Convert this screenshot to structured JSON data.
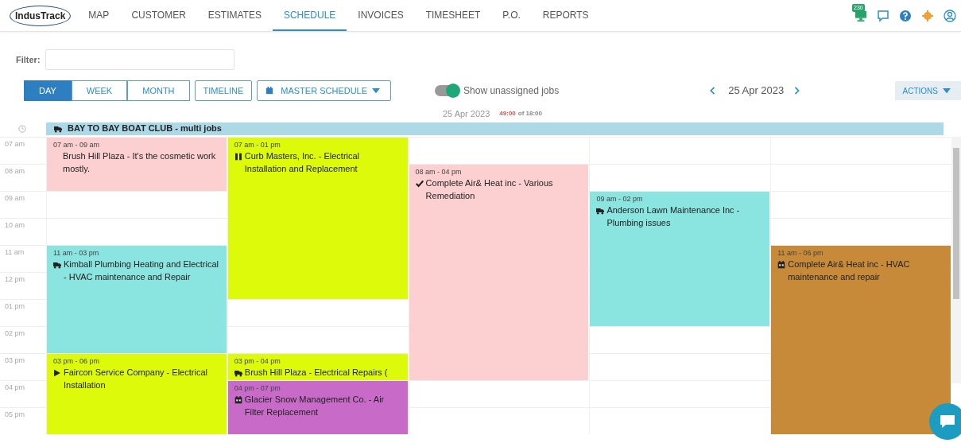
{
  "logo": "IndusTrack",
  "tabs": [
    {
      "label": "MAP",
      "selected": false
    },
    {
      "label": "CUSTOMER",
      "selected": false
    },
    {
      "label": "ESTIMATES",
      "selected": false
    },
    {
      "label": "SCHEDULE",
      "selected": true
    },
    {
      "label": "INVOICES",
      "selected": false
    },
    {
      "label": "TIMESHEET",
      "selected": false
    },
    {
      "label": "P.O.",
      "selected": false
    },
    {
      "label": "REPORTS",
      "selected": false
    }
  ],
  "notification_count": "230",
  "filter": {
    "label": "Filter:"
  },
  "views": [
    {
      "label": "DAY",
      "selected": true
    },
    {
      "label": "WEEK",
      "selected": false
    },
    {
      "label": "MONTH",
      "selected": false
    }
  ],
  "timeline_button": "TIMELINE",
  "schedule_dropdown": "MASTER SCHEDULE",
  "unassigned_toggle": {
    "label": "Show unassigned jobs",
    "on": true
  },
  "date_nav": "25 Apr 2023",
  "actions": "ACTIONS",
  "summary": {
    "date": "25 Apr 2023",
    "hours_used": "49:00",
    "hours_total": "of 18:00"
  },
  "all_day": {
    "title": "BAY TO BAY BOAT CLUB - multi jobs",
    "kind": "truck"
  },
  "calendar": {
    "time_slots": [
      "07 am",
      "08 am",
      "09 am",
      "10 am",
      "11 am",
      "12 pm",
      "01 pm",
      "02 pm",
      "03 pm",
      "04 pm",
      "05 pm"
    ],
    "lanes": [
      [
        {
          "time": "07 am - 09 am",
          "title": "Brush Hill Plaza - It's the cosmetic work mostly.",
          "kind": "plain",
          "color": "#fccfd0"
        },
        {
          "time": "11 am - 03 pm",
          "title": "Kimball Plumbing Heating and Electrical - HVAC maintenance and Repair",
          "kind": "truck",
          "color": "#8ae4e0"
        },
        {
          "time": "03 pm - 06 pm",
          "title": "Faircon Service Company - Electrical Installation",
          "kind": "play",
          "color": "#dcfa0a"
        }
      ],
      [
        {
          "time": "07 am - 01 pm",
          "title": "Curb Masters, Inc. - Electrical Installation and Replacement",
          "kind": "pause",
          "color": "#dcfa0a"
        },
        {
          "time": "03 pm - 04 pm",
          "title": "Brush Hill Plaza - Electrical Repairs (",
          "kind": "truck",
          "color": "#dcfa0a"
        },
        {
          "time": "04 pm - 07 pm",
          "title": "Glacier Snow Management Co. - Air Filter Replacement",
          "kind": "calendar",
          "color": "#c86bc8"
        }
      ],
      [
        {
          "time": "08 am - 04 pm",
          "title": "Complete Air& Heat inc - Various Remediation",
          "kind": "check",
          "color": "#fccfd0"
        }
      ],
      [
        {
          "time": "09 am - 02 pm",
          "title": "Anderson Lawn Maintenance Inc - Plumbing issues",
          "kind": "truck",
          "color": "#8ae4e0"
        }
      ],
      [
        {
          "time": "11 am - 06 pm",
          "title": "Complete Air& Heat inc - HVAC maintenance and repair",
          "kind": "calendar",
          "color": "#c68a38"
        }
      ]
    ]
  }
}
